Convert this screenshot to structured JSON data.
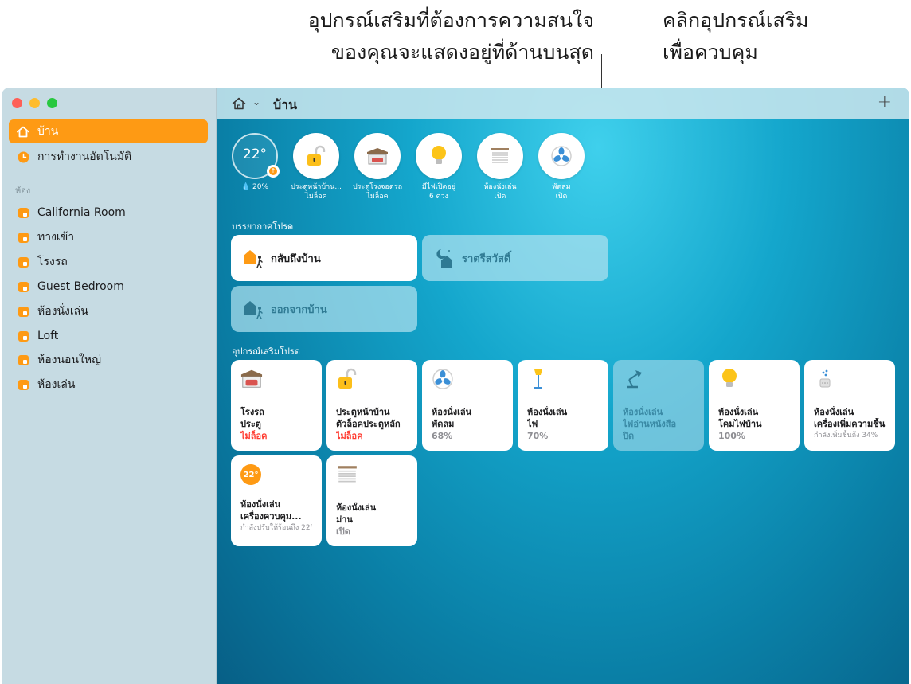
{
  "callouts": {
    "left_line1": "อุปกรณ์เสริมที่ต้องการความสนใจ",
    "left_line2": "ของคุณจะแสดงอยู่ที่ด้านบนสุด",
    "right_line1": "คลิกอุปกรณ์เสริม",
    "right_line2": "เพื่อควบคุม"
  },
  "sidebar": {
    "home": "บ้าน",
    "automation": "การทำงานอัตโนมัติ",
    "rooms_header": "ห้อง",
    "rooms": [
      "California Room",
      "ทางเข้า",
      "โรงรถ",
      "Guest Bedroom",
      "ห้องนั่งเล่น",
      "Loft",
      "ห้องนอนใหญ่",
      "ห้องเล่น"
    ]
  },
  "toolbar": {
    "title": "บ้าน",
    "chevron": "⌄",
    "plus": "+"
  },
  "status": {
    "temp_value": "22°",
    "humidity": "💧 20%",
    "items": [
      {
        "line1": "ประตูหน้าบ้าน...",
        "line2": "ไม่ล็อค",
        "icon": "unlocked-lock-icon"
      },
      {
        "line1": "ประตูโรงจอดรถ",
        "line2": "ไม่ล็อค",
        "icon": "garage-icon"
      },
      {
        "line1": "มีไฟเปิดอยู่",
        "line2": "6 ดวง",
        "icon": "lightbulb-icon"
      },
      {
        "line1": "ห้องนั่งเล่น",
        "line2": "เปิด",
        "icon": "blinds-icon"
      },
      {
        "line1": "พัดลม",
        "line2": "เปิด",
        "icon": "fan-icon"
      }
    ]
  },
  "scenes_title": "บรรยากาศโปรด",
  "scenes": [
    {
      "label": "กลับถึงบ้าน",
      "state": "on",
      "icon": "arrive-home-icon"
    },
    {
      "label": "ราตรีสวัสดิ์",
      "state": "off",
      "icon": "good-night-icon"
    },
    {
      "label": "ออกจากบ้าน",
      "state": "off",
      "icon": "leave-home-icon"
    }
  ],
  "accessories_title": "อุปกรณ์เสริมโปรด",
  "accessories": [
    {
      "l1": "โรงรถ",
      "l2": "ประตู",
      "l3": "ไม่ล็อค",
      "icon": "garage-icon",
      "state": "on",
      "alert": true
    },
    {
      "l1": "ประตูหน้าบ้าน",
      "l2": "ตัวล็อคประตูหลัก",
      "l3": "ไม่ล็อค",
      "icon": "unlocked-lock-icon",
      "state": "on",
      "alert": true
    },
    {
      "l1": "ห้องนั่งเล่น",
      "l2": "พัดลม",
      "l3": "68%",
      "icon": "fan-icon",
      "state": "on"
    },
    {
      "l1": "ห้องนั่งเล่น",
      "l2": "ไฟ",
      "l3": "70%",
      "icon": "floor-lamp-icon",
      "state": "on"
    },
    {
      "l1": "ห้องนั่งเล่น",
      "l2": "ไฟอ่านหนังสือ",
      "l3": "ปิด",
      "icon": "desk-lamp-icon",
      "state": "off"
    },
    {
      "l1": "ห้องนั่งเล่น",
      "l2": "โคมไฟบ้าน",
      "l3": "100%",
      "icon": "lightbulb-icon",
      "state": "on"
    },
    {
      "l1": "ห้องนั่งเล่น",
      "l2": "เครื่องเพิ่มความชื้น",
      "l3": "กำลังเพิ่มชื้นถึง 34%",
      "icon": "humidifier-icon",
      "state": "on",
      "small": true
    },
    {
      "l1": "ห้องนั่งเล่น",
      "l2": "เครื่องควบคุม...",
      "l3": "กำลังปรับให้ร้อนถึง 22°",
      "icon": "thermostat-icon",
      "state": "on",
      "small": true,
      "badge": "22°"
    },
    {
      "l1": "ห้องนั่งเล่น",
      "l2": "ม่าน",
      "l3": "เปิด",
      "icon": "blinds-icon",
      "state": "on"
    }
  ],
  "colors": {
    "accent": "#fe9a14",
    "alert": "#ff3b30",
    "sidebar": "#c6dbe3"
  }
}
